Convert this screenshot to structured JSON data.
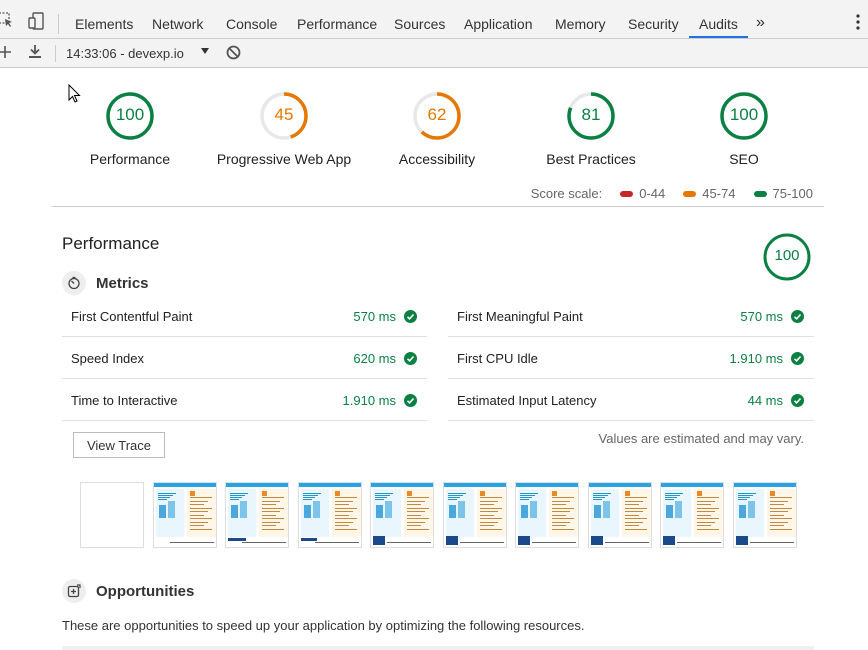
{
  "devtools": {
    "tabs": [
      "Elements",
      "Network",
      "Console",
      "Performance",
      "Sources",
      "Application",
      "Memory",
      "Security",
      "Audits"
    ],
    "active_tab": "Audits",
    "more_tabs_label": "»"
  },
  "toolbar": {
    "report_label": "14:33:06 - devexp.io"
  },
  "categories": [
    {
      "label": "Performance",
      "score": "100",
      "value": 100,
      "color": "#0b8043"
    },
    {
      "label": "Progressive Web App",
      "score": "45",
      "value": 45,
      "color": "#e67700"
    },
    {
      "label": "Accessibility",
      "score": "62",
      "value": 62,
      "color": "#e67700"
    },
    {
      "label": "Best Practices",
      "score": "81",
      "value": 81,
      "color": "#0b8043"
    },
    {
      "label": "SEO",
      "score": "100",
      "value": 100,
      "color": "#0b8043"
    }
  ],
  "score_scale": {
    "label": "Score scale:",
    "ranges": [
      {
        "label": "0-44",
        "color": "#c62828"
      },
      {
        "label": "45-74",
        "color": "#e67700"
      },
      {
        "label": "75-100",
        "color": "#0b8043"
      }
    ]
  },
  "performance": {
    "title": "Performance",
    "score": "100",
    "metrics_title": "Metrics",
    "metrics": [
      {
        "label": "First Contentful Paint",
        "value": "570 ms"
      },
      {
        "label": "First Meaningful Paint",
        "value": "570 ms"
      },
      {
        "label": "Speed Index",
        "value": "620 ms"
      },
      {
        "label": "First CPU Idle",
        "value": "1.910 ms"
      },
      {
        "label": "Time to Interactive",
        "value": "1.910 ms"
      },
      {
        "label": "Estimated Input Latency",
        "value": "44 ms"
      }
    ],
    "view_trace_label": "View Trace",
    "estimate_note": "Values are estimated and may vary."
  },
  "opportunities": {
    "title": "Opportunities",
    "description": "These are opportunities to speed up your application by optimizing the following resources."
  }
}
